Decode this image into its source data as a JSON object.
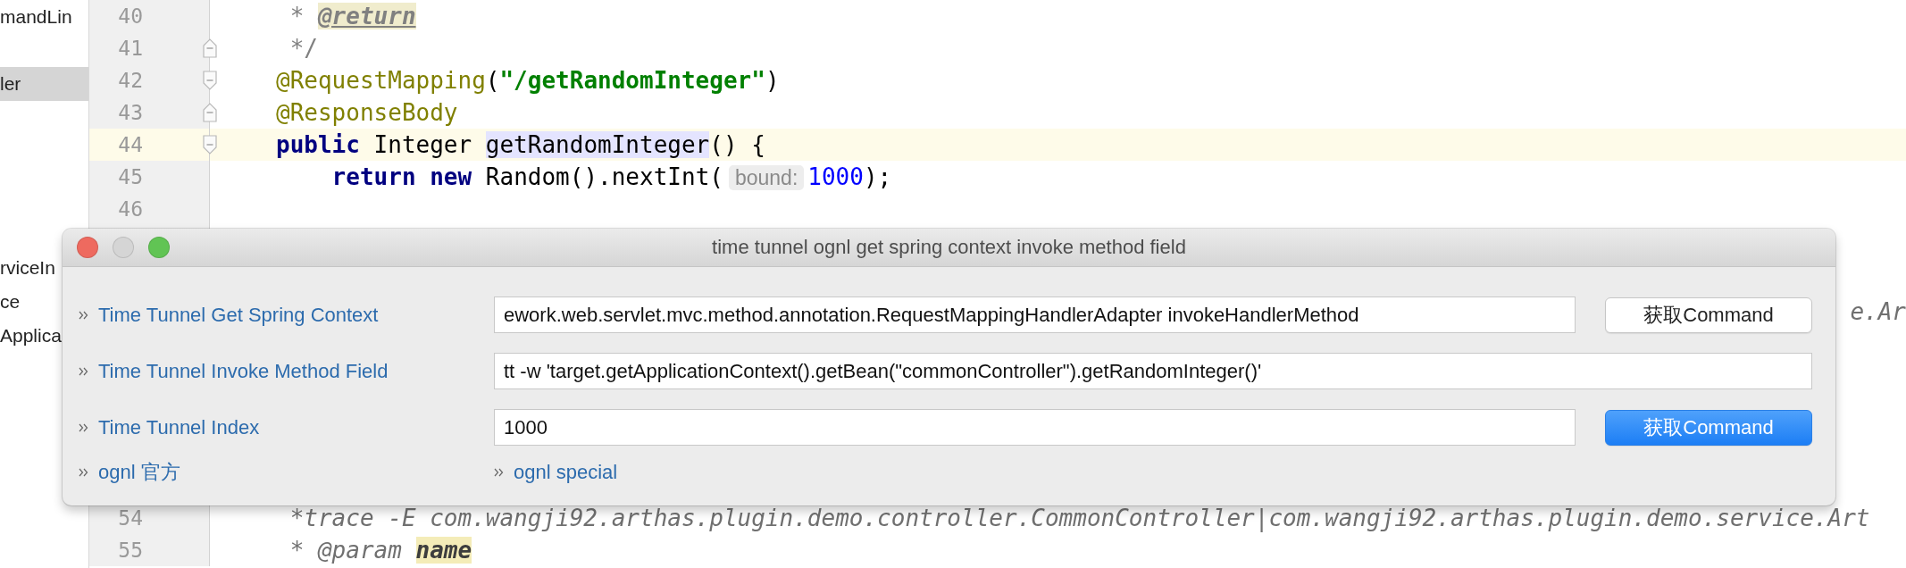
{
  "sidebar": {
    "sections": [
      [
        {
          "label": "mandLin",
          "selected": false
        }
      ],
      [
        {
          "label": "ler",
          "selected": true
        }
      ],
      [
        {
          "label": "rviceIn",
          "selected": false
        },
        {
          "label": "ce",
          "selected": false
        },
        {
          "label": "Applica",
          "selected": false
        }
      ]
    ]
  },
  "editor": {
    "lines_above": [
      {
        "number": "40",
        "fold_start": false,
        "fold_end": false,
        "current": false,
        "tokens": [
          {
            "kind": "comment",
            "text": " * "
          },
          {
            "kind": "doc-tag",
            "text": "@return"
          }
        ]
      },
      {
        "number": "41",
        "fold_start": false,
        "fold_end": true,
        "current": false,
        "tokens": [
          {
            "kind": "comment",
            "text": " */"
          }
        ]
      },
      {
        "number": "42",
        "fold_start": true,
        "fold_end": false,
        "current": false,
        "tokens": [
          {
            "kind": "annotation",
            "text": "@RequestMapping"
          },
          {
            "kind": "plain",
            "text": "("
          },
          {
            "kind": "string",
            "text": "\"/getRandomInteger\""
          },
          {
            "kind": "plain",
            "text": ")"
          }
        ]
      },
      {
        "number": "43",
        "fold_start": false,
        "fold_end": true,
        "current": false,
        "tokens": [
          {
            "kind": "annotation",
            "text": "@ResponseBody"
          }
        ]
      },
      {
        "number": "44",
        "fold_start": true,
        "fold_end": false,
        "current": true,
        "tokens": [
          {
            "kind": "keyword",
            "text": "public"
          },
          {
            "kind": "plain",
            "text": " Integer "
          },
          {
            "kind": "usage",
            "text": "getRandomInteger"
          },
          {
            "kind": "plain",
            "text": "() {"
          }
        ]
      },
      {
        "number": "45",
        "fold_start": false,
        "fold_end": false,
        "current": false,
        "tokens": [
          {
            "kind": "keyword",
            "text": "    return"
          },
          {
            "kind": "keyword",
            "text": " new"
          },
          {
            "kind": "plain",
            "text": " Random().nextInt("
          },
          {
            "kind": "hint",
            "text": "bound:"
          },
          {
            "kind": "number",
            "text": "1000"
          },
          {
            "kind": "plain",
            "text": ");"
          }
        ]
      },
      {
        "number": "46",
        "fold_start": false,
        "fold_end": false,
        "current": false
      }
    ],
    "partial_line": {
      "tokens": [
        {
          "kind": "doc-comment",
          "text": "e.Ar"
        }
      ]
    },
    "lines_below": [
      {
        "number": "54",
        "fold_start": false,
        "fold_end": false,
        "current": false,
        "tokens": [
          {
            "kind": "doc-comment",
            "text": " *trace -E com.wangji92.arthas.plugin.demo.controller.CommonController|com.wangji92.arthas.plugin.demo.service.Art"
          }
        ]
      },
      {
        "number": "55",
        "fold_start": false,
        "fold_end": false,
        "current": false,
        "tokens": [
          {
            "kind": "doc-comment",
            "text": " * @param "
          },
          {
            "kind": "param",
            "text": "name"
          }
        ]
      }
    ]
  },
  "dialog": {
    "title": "time tunnel ognl get spring context invoke method field",
    "window_controls": [
      {
        "kind": "close",
        "disabled": false
      },
      {
        "kind": "minimize",
        "disabled": true
      },
      {
        "kind": "zoom",
        "disabled": false
      }
    ],
    "rows": [
      {
        "label": "Time Tunnel Get Spring Context",
        "value": "ework.web.servlet.mvc.method.annotation.RequestMappingHandlerAdapter invokeHandlerMethod",
        "button": {
          "label": "获取Command",
          "primary": false
        }
      },
      {
        "label": "Time Tunnel Invoke Method Field",
        "value": "tt -w 'target.getApplicationContext().getBean(\"commonController\").getRandomInteger()'"
      },
      {
        "label": "Time Tunnel Index",
        "value": "1000",
        "button": {
          "label": "获取Command",
          "primary": true
        }
      }
    ],
    "links": [
      "ognl 官方",
      "ognl special"
    ]
  }
}
